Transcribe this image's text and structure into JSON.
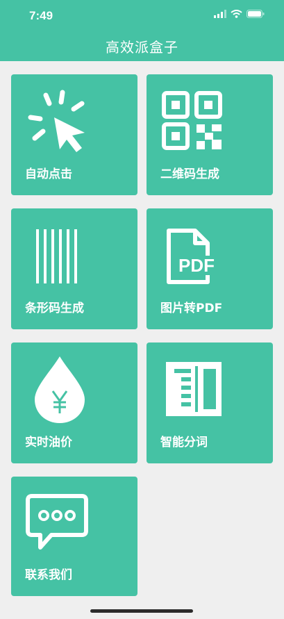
{
  "status": {
    "time": "7:49"
  },
  "header": {
    "title": "高效派盒子"
  },
  "tiles": [
    {
      "label": "自动点击",
      "icon": "cursor-click-icon"
    },
    {
      "label": "二维码生成",
      "icon": "qr-code-icon"
    },
    {
      "label": "条形码生成",
      "icon": "barcode-icon"
    },
    {
      "label": "图片转PDF",
      "icon": "pdf-file-icon"
    },
    {
      "label": "实时油价",
      "icon": "oil-drop-yen-icon"
    },
    {
      "label": "智能分词",
      "icon": "book-columns-icon"
    },
    {
      "label": "联系我们",
      "icon": "chat-bubble-icon"
    }
  ],
  "colors": {
    "accent": "#45c2a4",
    "background": "#efefef"
  }
}
